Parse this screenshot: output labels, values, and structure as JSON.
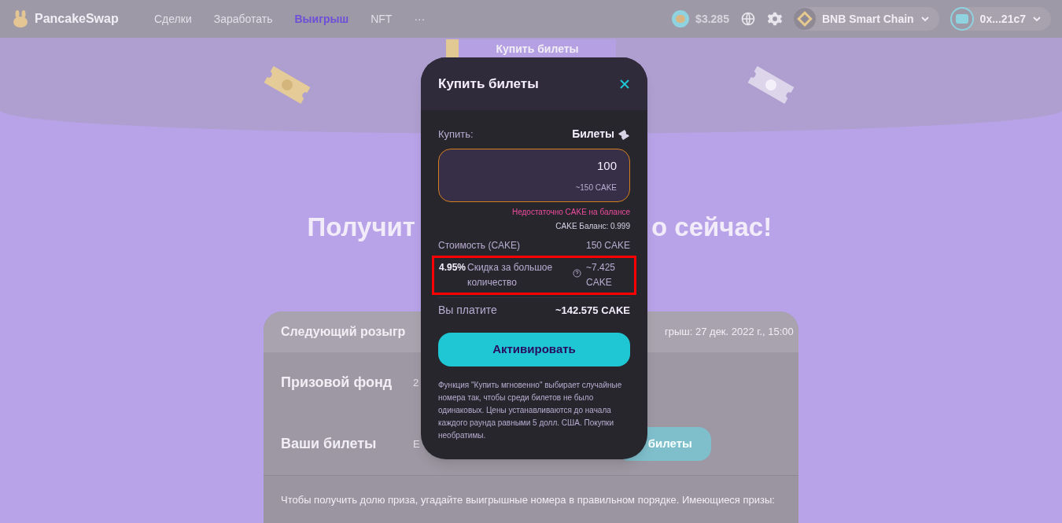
{
  "nav": {
    "brand": "PancakeSwap",
    "links": [
      {
        "label": "Сделки",
        "selected": false
      },
      {
        "label": "Заработать",
        "selected": false
      },
      {
        "label": "Выигрыш",
        "selected": true
      },
      {
        "label": "NFT",
        "selected": false
      },
      {
        "label": "···",
        "selected": false
      }
    ],
    "price": "$3.285",
    "network": "BNB Smart Chain",
    "wallet": "0x...21c7"
  },
  "page": {
    "buy_button": "Купить билеты",
    "heading_left": "Получит",
    "heading_right": "о сейчас!",
    "card": {
      "header_left": "Следующий розыгр",
      "header_right": "грыш: 27 дек. 2022 г., 15:00",
      "rows": [
        {
          "label": "Призовой фонд",
          "partial": "2"
        },
        {
          "label": "Ваши билеты",
          "partial": "Е",
          "button": "билеты"
        }
      ],
      "footer": "Чтобы получить долю приза, угадайте выигрышные номера в правильном порядке. Имеющиеся призы:"
    }
  },
  "modal": {
    "title": "Купить билеты",
    "buy_label": "Купить:",
    "unit": "Билеты",
    "input": {
      "value": "100",
      "hint": "~150 CAKE",
      "invalid": true
    },
    "error": "Недостаточно CAKE на балансе",
    "balance": "CAKE Баланс: 0.999",
    "cost": {
      "label": "Стоимость (CAKE)",
      "value": "150 CAKE"
    },
    "discount": {
      "percent": "4.95%",
      "label": "Скидка за большое количество",
      "value": "~7.425 CAKE",
      "highlighted": true
    },
    "pay": {
      "label": "Вы платите",
      "value": "~142.575 CAKE"
    },
    "action": "Активировать",
    "info": "Функция \"Купить мгновенно\" выбирает случайные номера так, чтобы среди билетов не было одинаковых. Цены устанавливаются до начала каждого раунда равными 5 долл. США. Покупки необратимы."
  }
}
